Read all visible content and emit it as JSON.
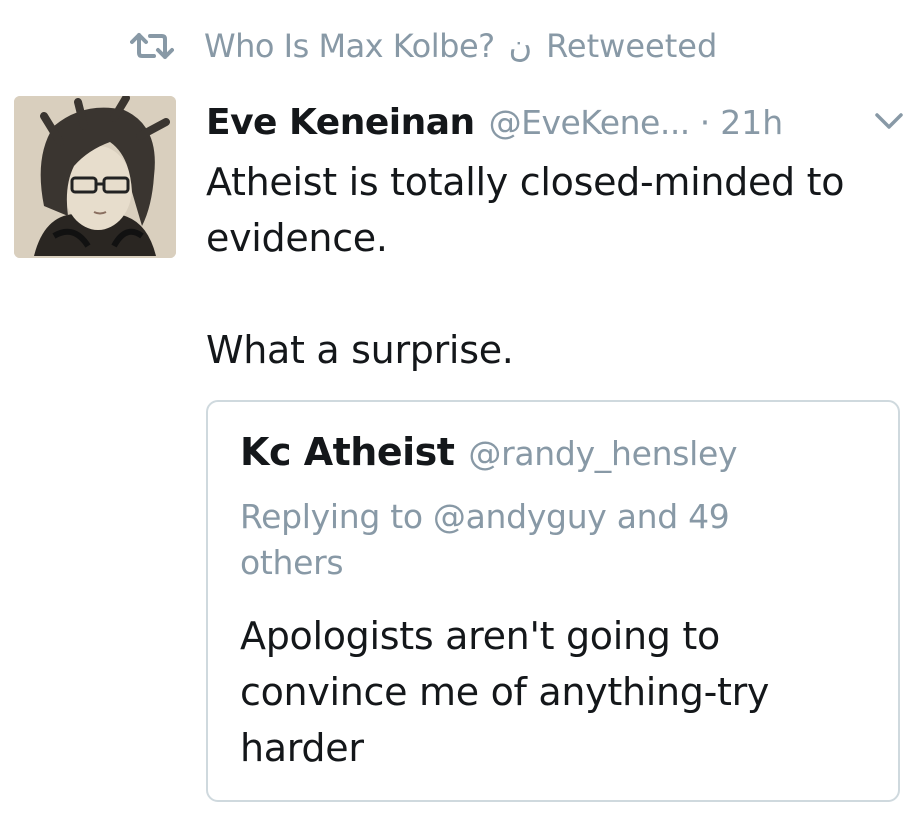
{
  "retweet_banner": {
    "icon": "retweet-icon",
    "retweeter": "Who Is Max Kolbe?",
    "decorative_glyph": "ن",
    "suffix": "Retweeted"
  },
  "tweet": {
    "avatar": "avatar-image",
    "display_name": "Eve Keneinan",
    "handle": "@EveKene...",
    "separator": "·",
    "timestamp": "21h",
    "menu_icon": "chevron-down-icon",
    "text_lines": [
      "Atheist is totally closed-minded to evidence.",
      "What a surprise."
    ]
  },
  "quoted_tweet": {
    "display_name": "Kc Atheist",
    "handle": "@randy_hensley",
    "replying_to": "Replying to @andyguy and 49 others",
    "text": "Apologists aren't going to convince me of anything-try harder"
  },
  "colors": {
    "text_primary": "#14171a",
    "text_secondary": "#8899a6",
    "border": "#cfd9de",
    "background": "#ffffff"
  }
}
